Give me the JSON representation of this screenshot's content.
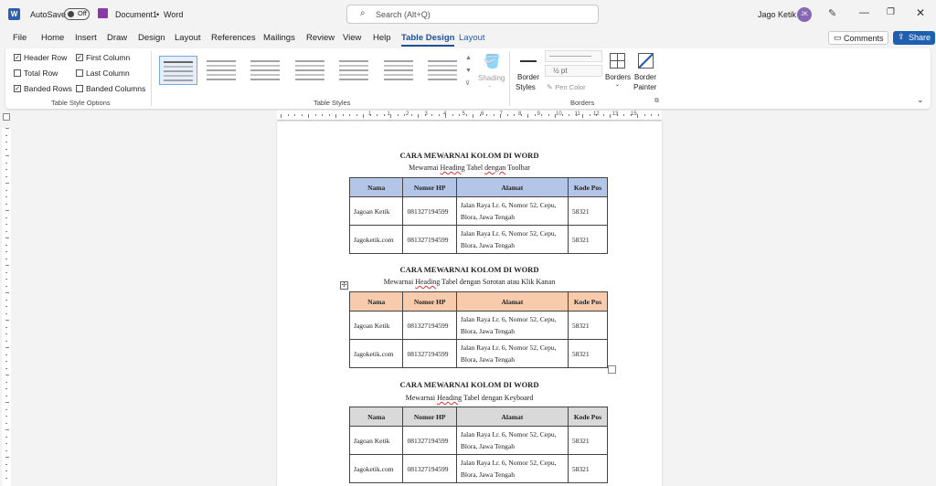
{
  "titlebar": {
    "autosave_label": "AutoSave",
    "autosave_state": "Off",
    "doc_name": "Document1",
    "separator": "•",
    "app_name": "Word",
    "search_placeholder": "Search (Alt+Q)",
    "user_name": "Jago Ketik",
    "user_initials": "JK"
  },
  "menu": {
    "tabs": [
      "File",
      "Home",
      "Insert",
      "Draw",
      "Design",
      "Layout",
      "References",
      "Mailings",
      "Review",
      "View",
      "Help",
      "Table Design",
      "Layout"
    ],
    "active_tab": "Table Design",
    "comments_label": "Comments",
    "share_label": "Share"
  },
  "ribbon": {
    "style_options": {
      "header_row": {
        "label": "Header Row",
        "checked": true
      },
      "first_column": {
        "label": "First Column",
        "checked": true
      },
      "total_row": {
        "label": "Total Row",
        "checked": false
      },
      "last_column": {
        "label": "Last Column",
        "checked": false
      },
      "banded_rows": {
        "label": "Banded Rows",
        "checked": true
      },
      "banded_columns": {
        "label": "Banded Columns",
        "checked": false
      },
      "group_label": "Table Style Options"
    },
    "table_styles_label": "Table Styles",
    "shading_label": "Shading",
    "border_styles_label": [
      "Border",
      "Styles"
    ],
    "pen_weight": "½ pt",
    "pen_color_label": "Pen Color",
    "borders_label": "Borders",
    "border_painter_label": [
      "Border",
      "Painter"
    ],
    "borders_group_label": "Borders"
  },
  "ruler": {
    "marks": [
      "1",
      "1",
      "2",
      "3",
      "4",
      "5",
      "6",
      "7",
      "8",
      "9",
      "10",
      "11",
      "12",
      "13",
      "15"
    ]
  },
  "document": {
    "sections": [
      {
        "title": "CARA MEWARNAI KOLOM DI WORD",
        "subtitle_parts": [
          "Mewarnai ",
          "Heading",
          " Tabel ",
          "dengan",
          " Toolbar"
        ],
        "header_color": "#b4c6e7"
      },
      {
        "title": "CARA MEWARNAI KOLOM DI WORD",
        "subtitle_parts": [
          "Mewarnai ",
          "Heading",
          " Tabel dengan Sorotan atau Klik Kanan",
          "",
          ""
        ],
        "header_color": "#f8cbad"
      },
      {
        "title": "CARA MEWARNAI KOLOM DI WORD",
        "subtitle_parts": [
          "Mewarnai ",
          "Heading",
          " Tabel dengan Keyboard",
          "",
          ""
        ],
        "header_color": "#d9d9d9"
      }
    ],
    "table_headers": [
      "Nama",
      "Nomor HP",
      "Alamat",
      "Kode Pos"
    ],
    "table_rows": [
      [
        "Jagoan Ketik",
        "081327194599",
        "Jalan Raya Lr. 6, Nomor 52, Cepu, Blora, Jawa Tengah",
        "58321"
      ],
      [
        "Jagoketik.com",
        "081327194599",
        "Jalan Raya Lr. 6, Nomor 52, Cepu, Blora, Jawa Tengah",
        "58321"
      ]
    ]
  }
}
